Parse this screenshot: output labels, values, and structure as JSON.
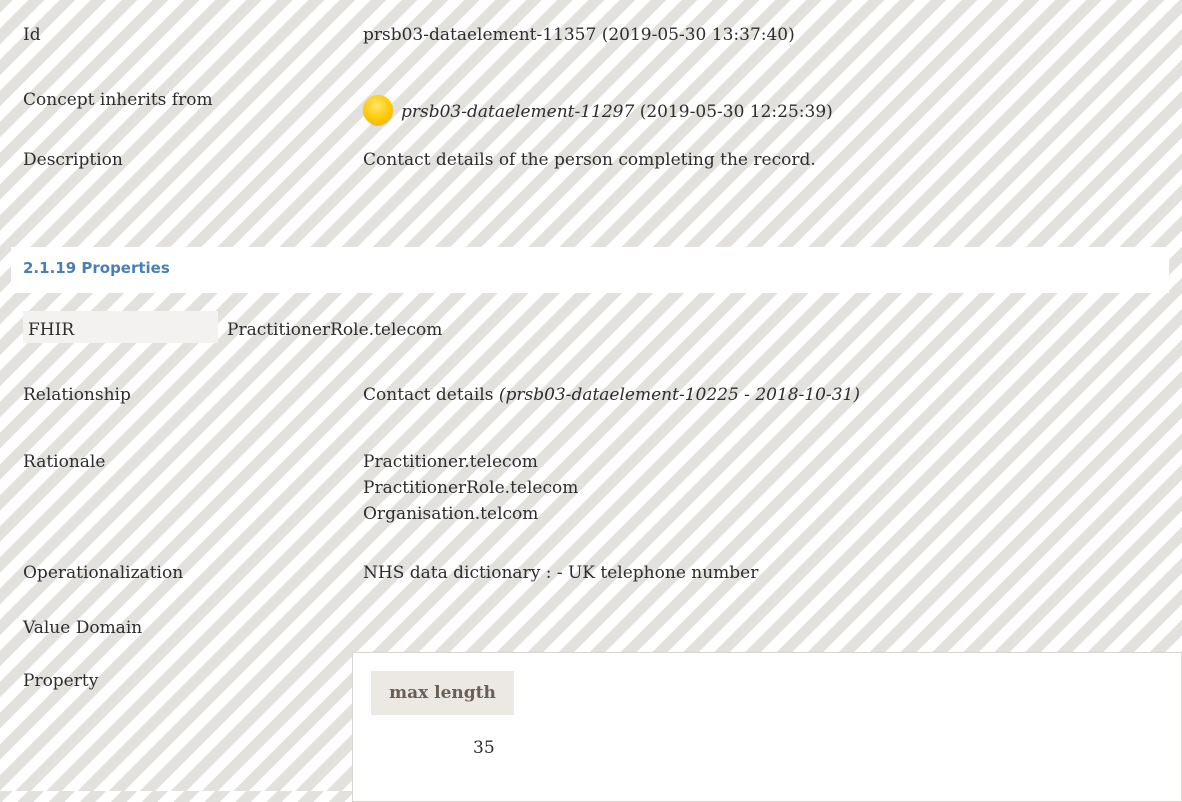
{
  "rows": {
    "id": {
      "label": "Id",
      "value": "prsb03-dataelement-11357 (2019-05-30 13:37:40)"
    },
    "inherits": {
      "label": "Concept inherits from",
      "link": "prsb03-dataelement-11297",
      "date": " (2019-05-30 12:25:39)"
    },
    "description": {
      "label": "Description",
      "value": "Contact details of the person completing the record."
    }
  },
  "section": {
    "title": "2.1.19 Properties"
  },
  "props": {
    "fhir": {
      "label": "FHIR",
      "value": "PractitionerRole.telecom"
    },
    "relationship": {
      "label": "Relationship",
      "value": "Contact details ",
      "ref": "(prsb03-dataelement-10225 - 2018-10-31)"
    },
    "rationale": {
      "label": "Rationale",
      "lines": [
        "Practitioner.telecom",
        "PractitionerRole.telecom",
        "Organisation.telcom"
      ]
    },
    "operationalization": {
      "label": "Operationalization",
      "value": "NHS data dictionary : - UK telephone number"
    },
    "value_domain": {
      "label": "Value Domain"
    },
    "property": {
      "label": "Property",
      "header": "max length",
      "value": "35"
    }
  },
  "colors": {
    "section_title": "#4a7fb6",
    "status_dot": "#ffc800",
    "stripe": "#e3e1de"
  },
  "icons": {
    "status": "status-dot-icon"
  }
}
